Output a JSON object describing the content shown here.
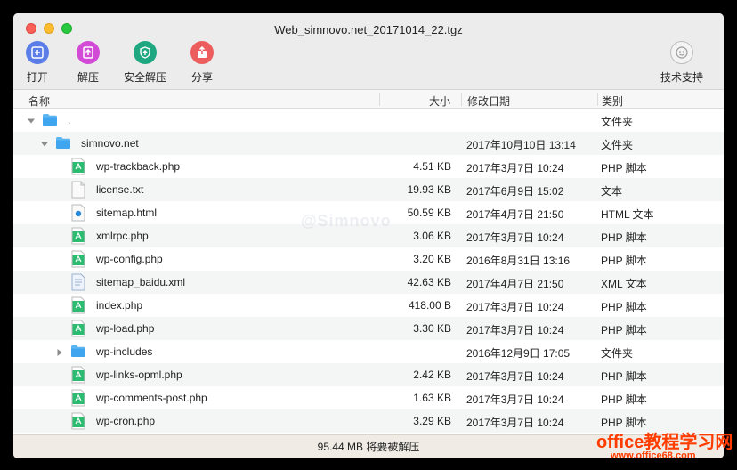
{
  "window": {
    "title": "Web_simnovo.net_20171014_22.tgz"
  },
  "toolbar": {
    "open": {
      "label": "打开",
      "icon": "open-icon",
      "color": "#5b7de8"
    },
    "extract": {
      "label": "解压",
      "icon": "extract-icon",
      "color": "#d14bd6"
    },
    "safe_extract": {
      "label": "安全解压",
      "icon": "shield-icon",
      "color": "#1fa781"
    },
    "share": {
      "label": "分享",
      "icon": "share-icon",
      "color": "#ec5d5d"
    },
    "support": {
      "label": "技术支持",
      "icon": "support-icon"
    }
  },
  "columns": {
    "name": "名称",
    "size": "大小",
    "date": "修改日期",
    "kind": "类别"
  },
  "rows": [
    {
      "name": ".",
      "size": "",
      "date": "",
      "kind": "文件夹",
      "type": "folder",
      "level": 0,
      "expanded": true
    },
    {
      "name": "simnovo.net",
      "size": "",
      "date": "2017年10月10日 13:14",
      "kind": "文件夹",
      "type": "folder",
      "level": 1,
      "expanded": true
    },
    {
      "name": "wp-trackback.php",
      "size": "4.51 KB",
      "date": "2017年3月7日 10:24",
      "kind": "PHP 脚本",
      "type": "php",
      "level": 2
    },
    {
      "name": "license.txt",
      "size": "19.93 KB",
      "date": "2017年6月9日 15:02",
      "kind": "文本",
      "type": "txt",
      "level": 2
    },
    {
      "name": "sitemap.html",
      "size": "50.59 KB",
      "date": "2017年4月7日 21:50",
      "kind": "HTML 文本",
      "type": "html",
      "level": 2
    },
    {
      "name": "xmlrpc.php",
      "size": "3.06 KB",
      "date": "2017年3月7日 10:24",
      "kind": "PHP 脚本",
      "type": "php",
      "level": 2
    },
    {
      "name": "wp-config.php",
      "size": "3.20 KB",
      "date": "2016年8月31日 13:16",
      "kind": "PHP 脚本",
      "type": "php",
      "level": 2
    },
    {
      "name": "sitemap_baidu.xml",
      "size": "42.63 KB",
      "date": "2017年4月7日 21:50",
      "kind": "XML 文本",
      "type": "xml",
      "level": 2
    },
    {
      "name": "index.php",
      "size": "418.00 B",
      "date": "2017年3月7日 10:24",
      "kind": "PHP 脚本",
      "type": "php",
      "level": 2
    },
    {
      "name": "wp-load.php",
      "size": "3.30 KB",
      "date": "2017年3月7日 10:24",
      "kind": "PHP 脚本",
      "type": "php",
      "level": 2
    },
    {
      "name": "wp-includes",
      "size": "",
      "date": "2016年12月9日 17:05",
      "kind": "文件夹",
      "type": "folder",
      "level": 2,
      "expanded": false
    },
    {
      "name": "wp-links-opml.php",
      "size": "2.42 KB",
      "date": "2017年3月7日 10:24",
      "kind": "PHP 脚本",
      "type": "php",
      "level": 2
    },
    {
      "name": "wp-comments-post.php",
      "size": "1.63 KB",
      "date": "2017年3月7日 10:24",
      "kind": "PHP 脚本",
      "type": "php",
      "level": 2
    },
    {
      "name": "wp-cron.php",
      "size": "3.29 KB",
      "date": "2017年3月7日 10:24",
      "kind": "PHP 脚本",
      "type": "php",
      "level": 2
    }
  ],
  "status": {
    "text": "95.44 MB 将要被解压"
  },
  "watermarks": {
    "center": "@Simnovo",
    "brand": "office教程学习网",
    "url": "www.office68.com"
  }
}
